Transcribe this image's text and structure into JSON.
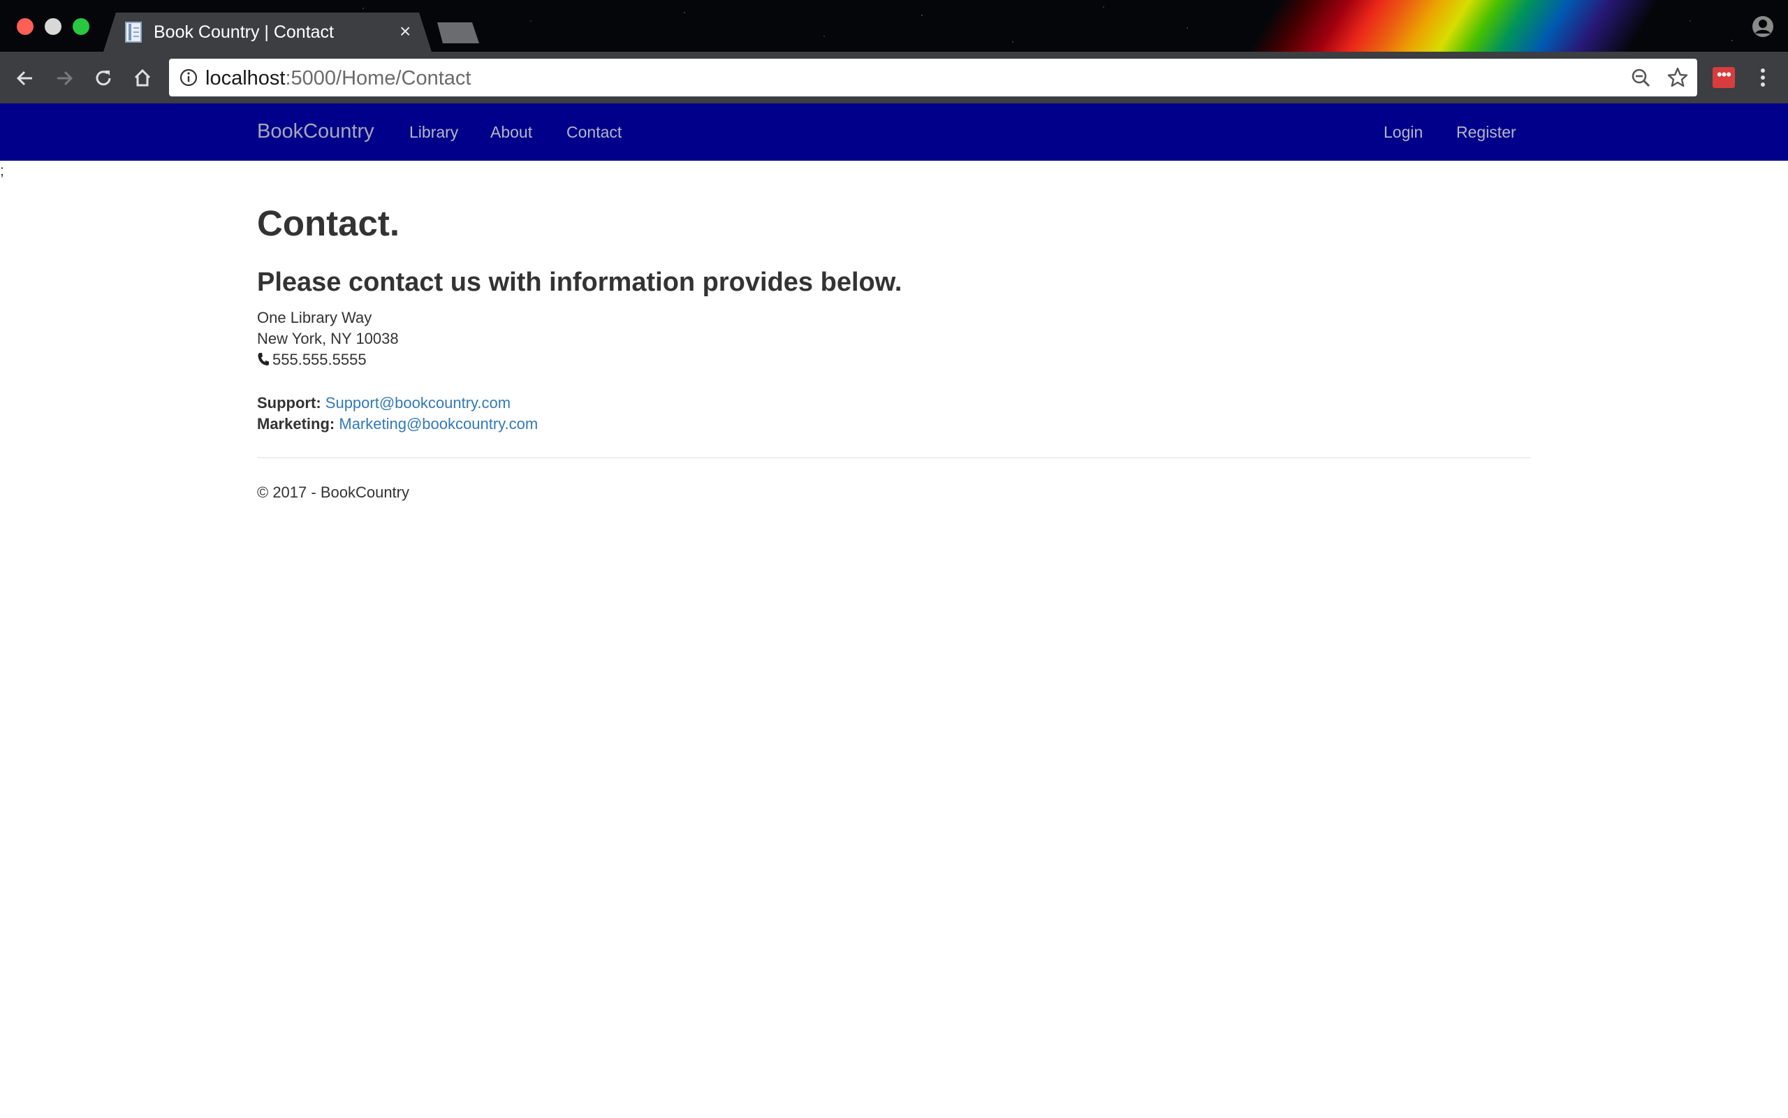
{
  "browser": {
    "tab_title": "Book Country | Contact",
    "tab_close": "×",
    "url_host": "localhost",
    "url_rest": ":5000/Home/Contact",
    "extension_label": "•••"
  },
  "navbar": {
    "brand": "BookCountry",
    "links": [
      "Library",
      "About",
      "Contact"
    ],
    "right_links": [
      "Login",
      "Register"
    ],
    "background_color": "#00008b"
  },
  "stray_text": ";",
  "page": {
    "title": "Contact.",
    "subtitle": "Please contact us with information provides below.",
    "address": {
      "street": "One Library Way",
      "city": "New York, NY 10038",
      "phone": "555.555.5555"
    },
    "support_label": "Support:",
    "support_email": "Support@bookcountry.com",
    "marketing_label": "Marketing:",
    "marketing_email": "Marketing@bookcountry.com",
    "link_color": "#337ab7"
  },
  "footer": {
    "text": "© 2017 - BookCountry"
  }
}
